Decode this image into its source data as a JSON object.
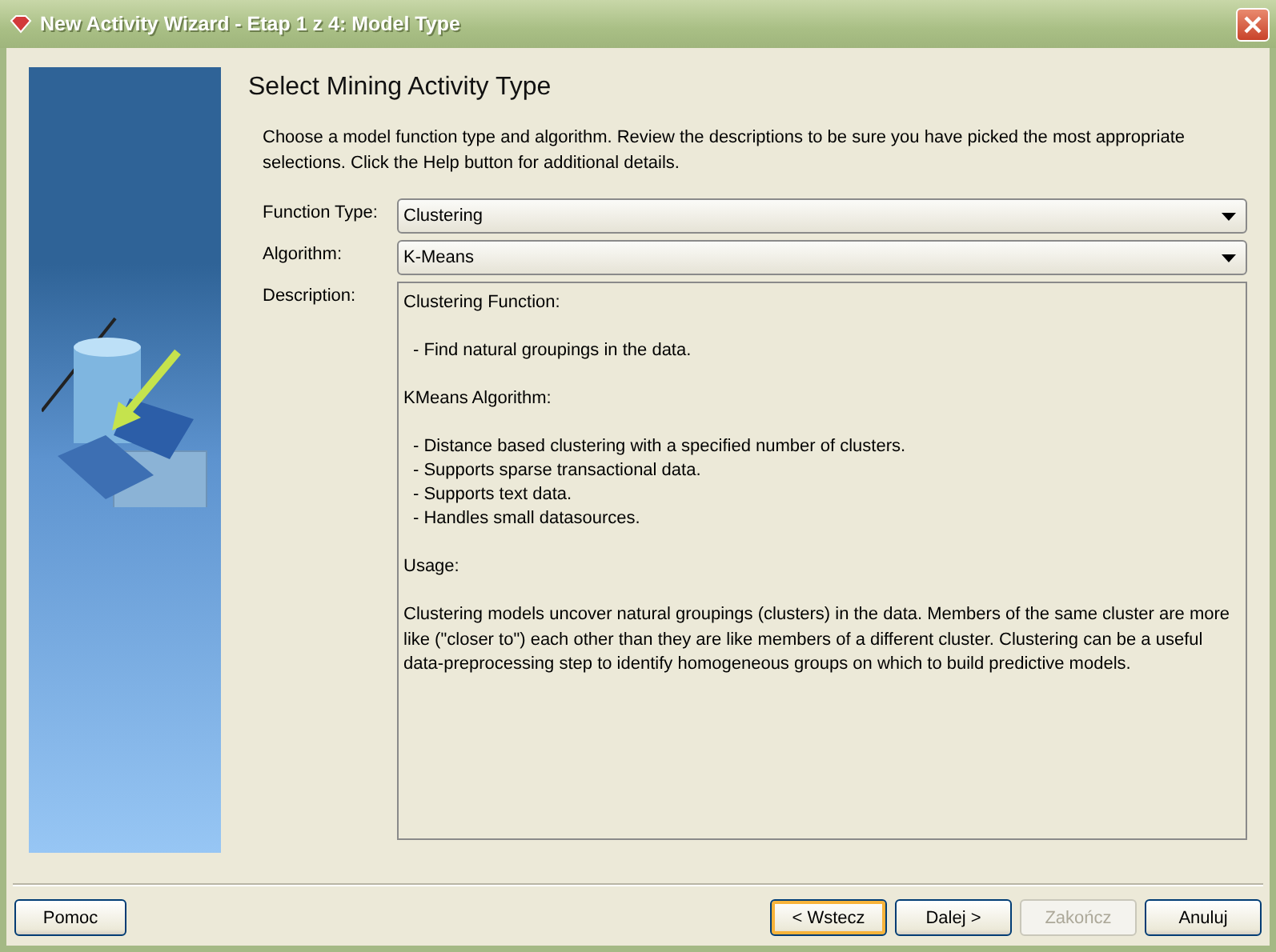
{
  "window": {
    "title": "New Activity Wizard - Etap 1 z 4: Model Type"
  },
  "heading": "Select Mining Activity Type",
  "intro": "Choose a model function type and algorithm.  Review the descriptions to be sure you have picked the most appropriate selections. Click the Help button for additional details.",
  "fields": [
    {
      "label": "Function Type:",
      "value": "Clustering"
    },
    {
      "label": "Algorithm:",
      "value": "K-Means"
    }
  ],
  "description": {
    "label": "Description:",
    "blocks": [
      {
        "kind": "heading",
        "lines": [
          "Clustering Function:"
        ]
      },
      {
        "kind": "bullets",
        "lines": [
          "- Find natural groupings in the data."
        ]
      },
      {
        "kind": "heading",
        "lines": [
          "KMeans Algorithm:"
        ]
      },
      {
        "kind": "bullets",
        "lines": [
          "- Distance based clustering with a specified number of clusters.",
          "- Supports sparse transactional data.",
          "- Supports text data.",
          "- Handles small datasources."
        ]
      },
      {
        "kind": "heading",
        "lines": [
          "Usage:"
        ]
      },
      {
        "kind": "paragraph",
        "lines": [
          "Clustering models uncover natural groupings (clusters) in the data. Members of the same cluster are more like (\"closer to\") each other than they are like members of a different cluster. Clustering can be a useful data-preprocessing step to identify homogeneous groups on which to build predictive models."
        ]
      }
    ]
  },
  "help_button": {
    "label": "Pomoc"
  },
  "buttons": [
    {
      "label": "< Wstecz",
      "focused": true,
      "disabled": false
    },
    {
      "label": "Dalej >",
      "focused": false,
      "disabled": false
    },
    {
      "label": "Zakończ",
      "focused": false,
      "disabled": true
    },
    {
      "label": "Anuluj",
      "focused": false,
      "disabled": false
    }
  ]
}
